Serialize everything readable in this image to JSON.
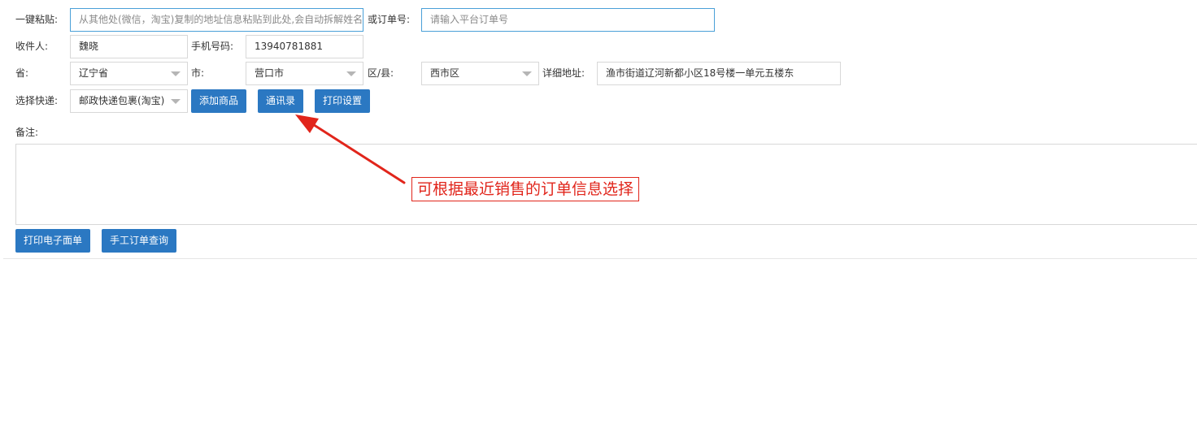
{
  "row1": {
    "paste_label": "一键粘贴:",
    "paste_placeholder": "从其他处(微信，淘宝)复制的地址信息粘贴到此处,会自动拆解姓名",
    "order_label": "或订单号:",
    "order_placeholder": "请输入平台订单号"
  },
  "row2": {
    "receiver_label": "收件人:",
    "receiver_value": "魏晓",
    "phone_label": "手机号码:",
    "phone_value": "13940781881"
  },
  "row3": {
    "province_label": "省:",
    "province_value": "辽宁省",
    "city_label": "市:",
    "city_value": "营口市",
    "district_label": "区/县:",
    "district_value": "西市区",
    "address_label": "详细地址:",
    "address_value": "渔市街道辽河新都小区18号楼一单元五楼东"
  },
  "row4": {
    "express_label": "选择快递:",
    "express_value": "邮政快递包裹(淘宝)",
    "add_goods_label": "添加商品",
    "contacts_label": "通讯录",
    "print_settings_label": "打印设置"
  },
  "remark": {
    "label": "备注:"
  },
  "actions": {
    "print_waybill_label": "打印电子面单",
    "manual_query_label": "手工订单查询"
  },
  "annotation": {
    "text": "可根据最近销售的订单信息选择",
    "color": "#e1251b"
  },
  "colors": {
    "button": "#2b78c2",
    "focus_border": "#4aa0d8"
  }
}
